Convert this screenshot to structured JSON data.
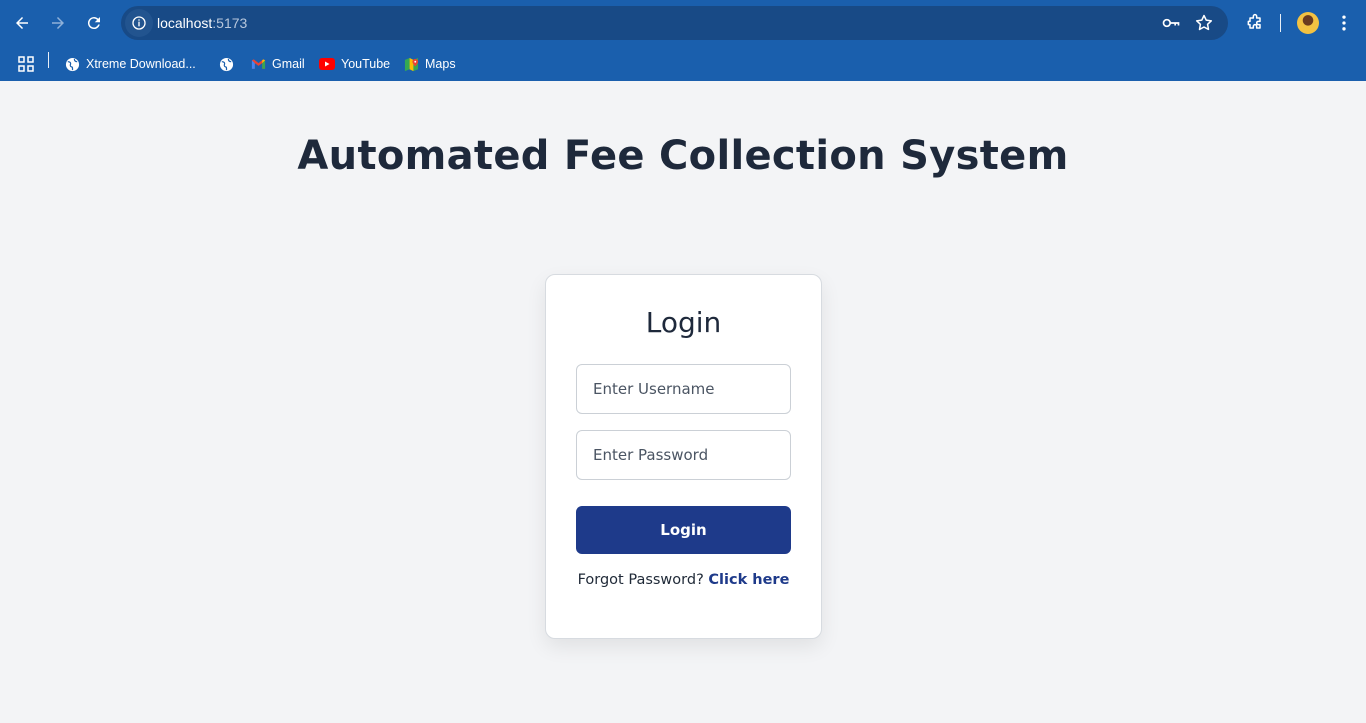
{
  "browser": {
    "url_host": "localhost",
    "url_port": ":5173",
    "bookmarks": [
      {
        "label": "Xtreme Download...",
        "icon": "globe-icon"
      },
      {
        "label": "",
        "icon": "globe-icon"
      },
      {
        "label": "Gmail",
        "icon": "gmail-icon"
      },
      {
        "label": "YouTube",
        "icon": "youtube-icon"
      },
      {
        "label": "Maps",
        "icon": "maps-icon"
      }
    ],
    "colors": {
      "toolbar": "#1a5fad",
      "omnibox": "#184a86"
    }
  },
  "page": {
    "title": "Automated Fee Collection System",
    "login": {
      "heading": "Login",
      "username_placeholder": "Enter Username",
      "password_placeholder": "Enter Password",
      "button_label": "Login",
      "forgot_text": "Forgot Password?",
      "forgot_link": "Click here"
    },
    "colors": {
      "accent": "#1e3a8a",
      "background": "#f3f4f6",
      "title": "#1e293b"
    }
  }
}
